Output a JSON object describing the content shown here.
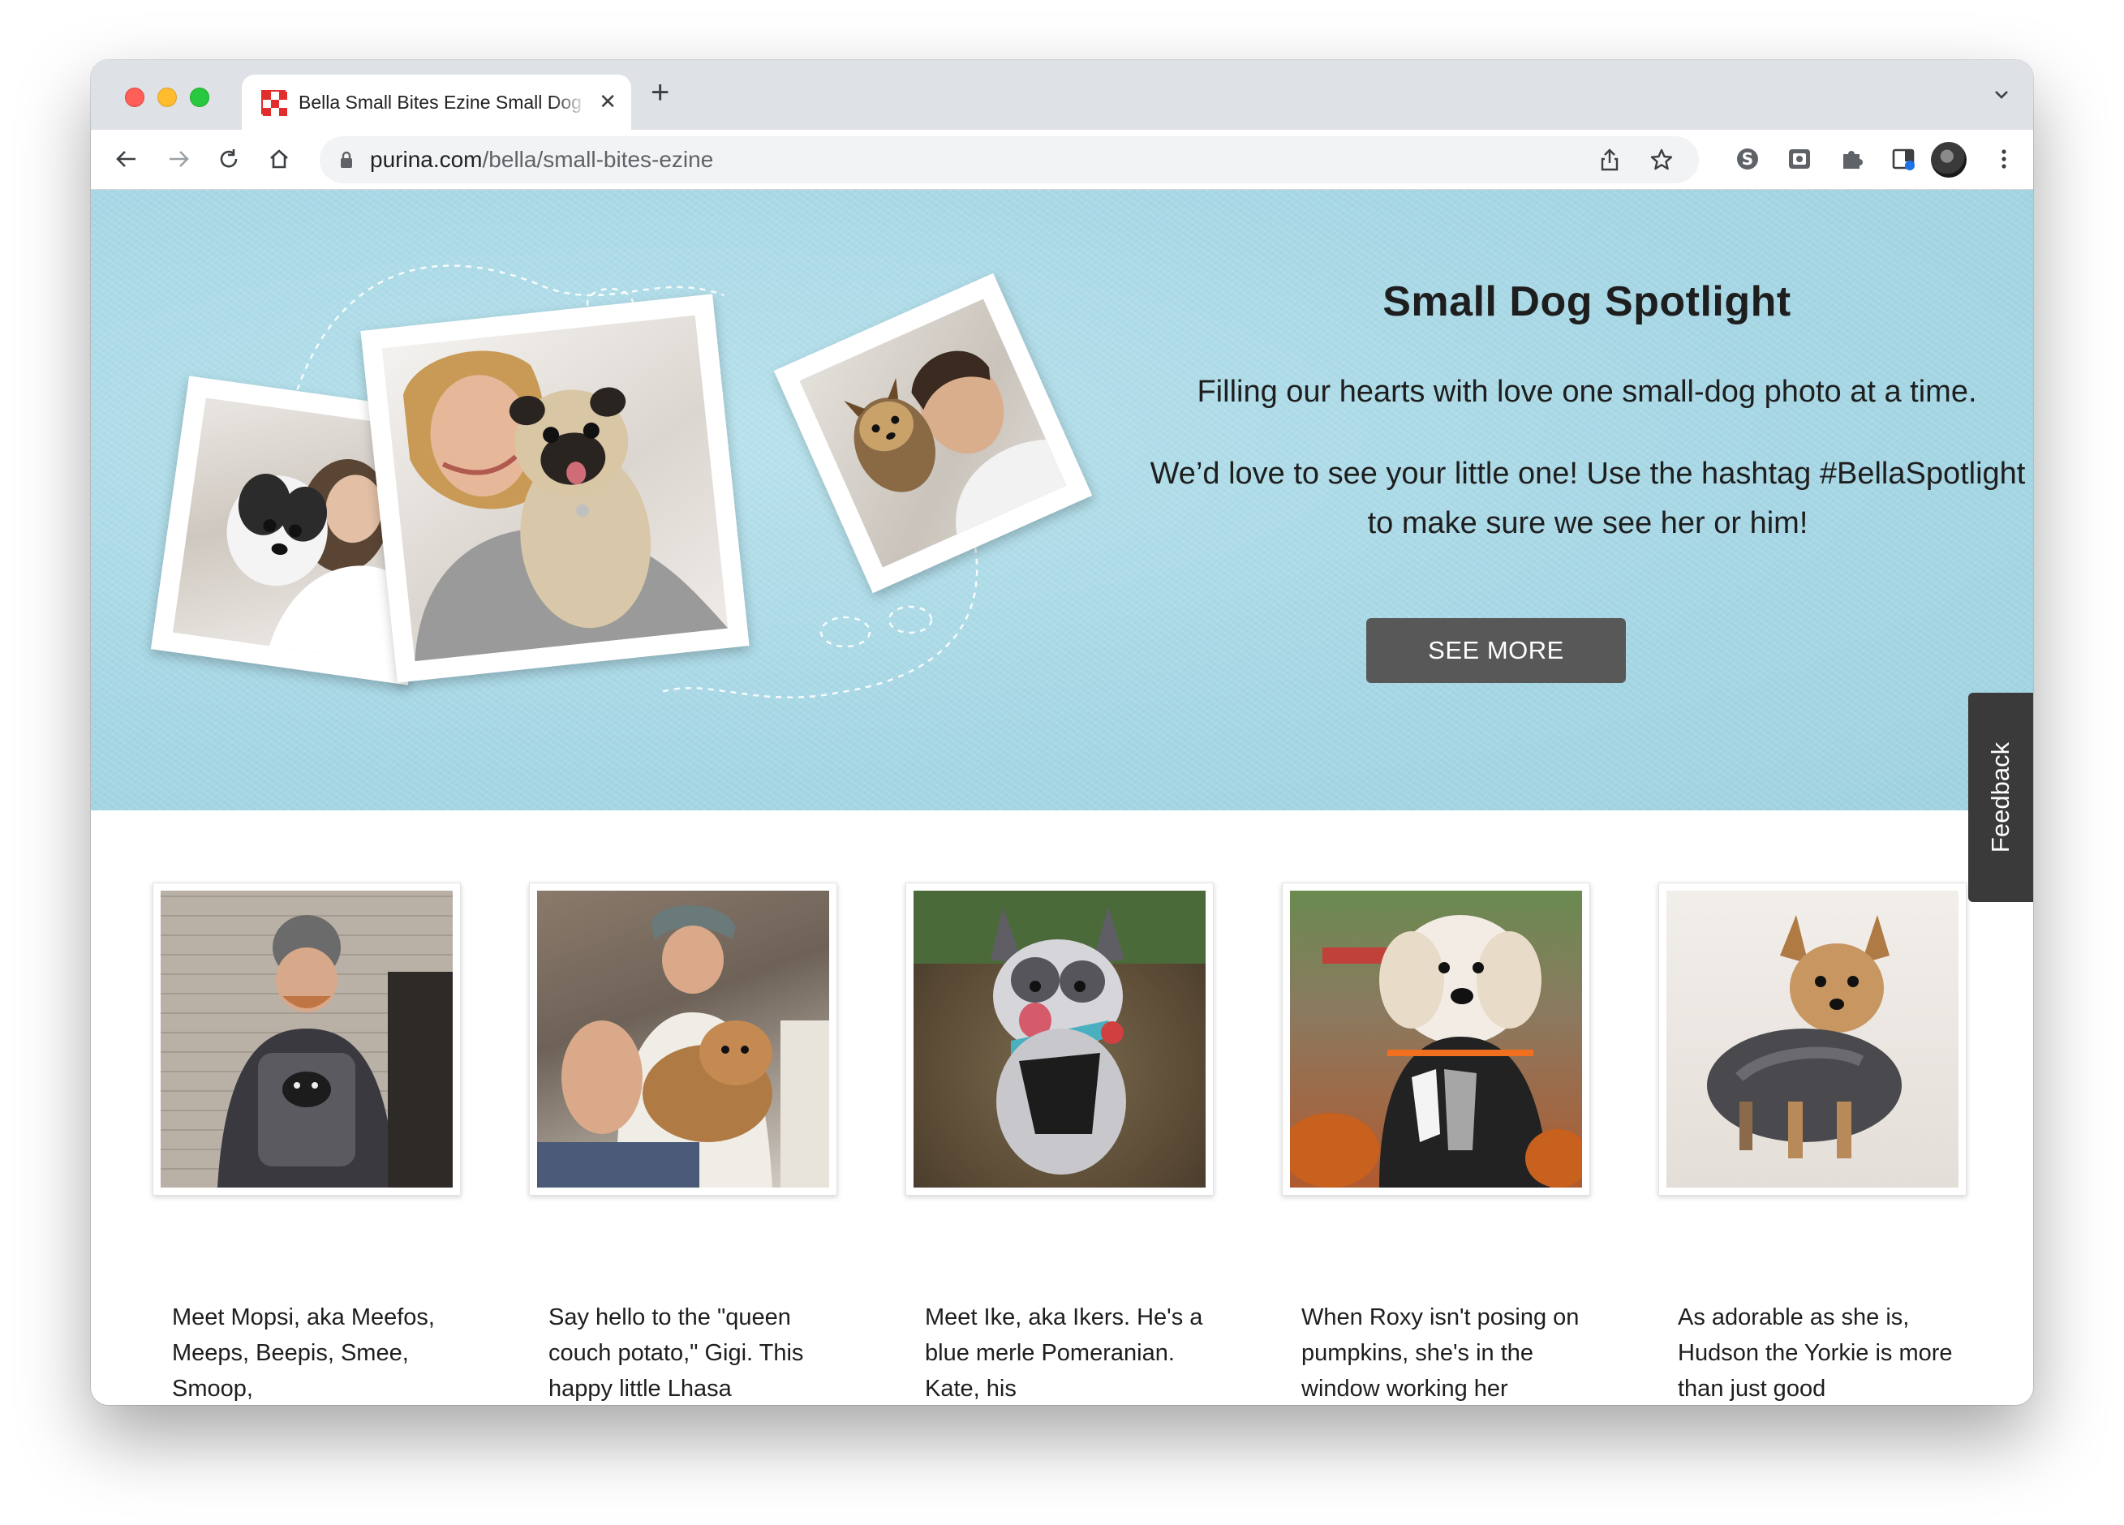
{
  "browser": {
    "tab_title": "Bella Small Bites Ezine Small Dog",
    "url_domain": "purina.com",
    "url_path": "/bella/small-bites-ezine",
    "colors": {
      "tabstrip": "#dee1e6",
      "omnibox": "#f1f3f4"
    }
  },
  "hero": {
    "title": "Small Dog Spotlight",
    "subtitle": "Filling our hearts with love one small-dog photo at a time.",
    "body": "We’d love to see your little one! Use the hashtag #BellaSpotlight to make sure we see her or him!",
    "button_label": "SEE MORE",
    "colors": {
      "background": "#a9d9e6",
      "button": "#585858"
    }
  },
  "feedback_label": "Feedback",
  "cards": [
    {
      "caption": "Meet Mopsi, aka Meefos, Meeps, Beepis, Smee, Smoop,"
    },
    {
      "caption": "Say hello to the \"queen couch potato,\" Gigi. This happy little Lhasa"
    },
    {
      "caption": "Meet Ike, aka Ikers. He's a blue merle Pomeranian. Kate, his"
    },
    {
      "caption": "When Roxy isn't posing on pumpkins, she's in the window working her"
    },
    {
      "caption": "As adorable as she is, Hudson the Yorkie is more than just good"
    }
  ]
}
